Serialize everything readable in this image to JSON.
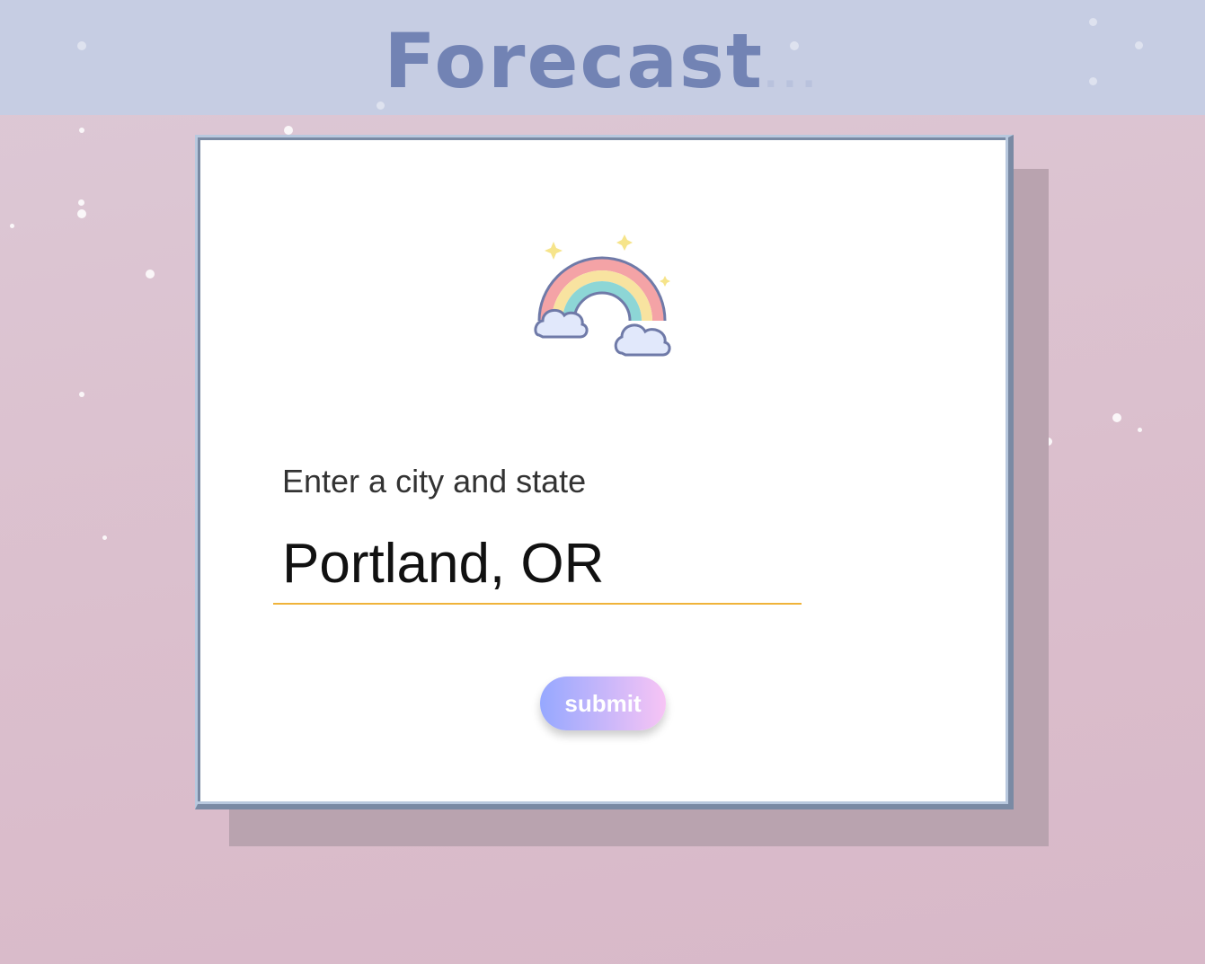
{
  "header": {
    "title": "Forecast",
    "title_suffix": "...",
    "title_color": "#7283b4",
    "background_color": "#c6cde3"
  },
  "form": {
    "icon": "rainbow-icon",
    "label": "Enter a city and state",
    "input_value": "Portland, OR",
    "input_underline_color": "#f0b33a",
    "submit_label": "submit"
  }
}
